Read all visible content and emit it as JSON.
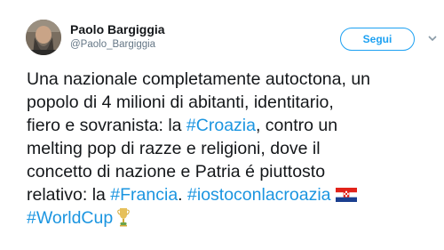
{
  "user": {
    "name": "Paolo Bargiggia",
    "handle": "@Paolo_Bargiggia"
  },
  "follow_button": {
    "label": "Segui"
  },
  "icons": {
    "caret": "chevron-down-icon",
    "flag": "croatia-flag-icon",
    "trophy": "trophy-icon"
  },
  "colors": {
    "link": "#1b95e0",
    "follow": "#1da1f2",
    "text": "#14171a",
    "muted": "#657786"
  },
  "tweet": {
    "line1": "Una nazionale completamente autoctona, un",
    "line2": "popolo di 4 milioni di abitanti, identitario,",
    "line3_a": "fiero e sovranista:  la ",
    "line3_tag": "#Croazia",
    "line3_b": ", contro un",
    "line4": "melting pop di razze e religioni, dove il",
    "line5": "concetto di nazione e Patria é  piuttosto",
    "line6_a": "relativo: la ",
    "line6_tag1": "#Francia",
    "line6_b": ". ",
    "line6_tag2": "#iostoconlacroazia",
    "line7_tag": "#WorldCup"
  }
}
